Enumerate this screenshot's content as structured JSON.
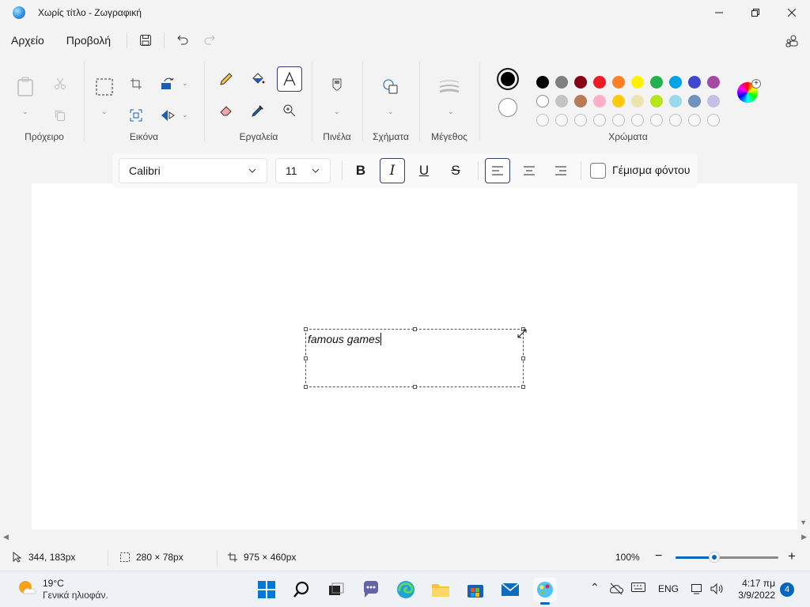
{
  "window": {
    "title": "Χωρίς τίτλο - Ζωγραφική",
    "minimize_icon": "minimize-icon",
    "maximize_icon": "maximize-icon",
    "close_icon": "close-icon"
  },
  "menu": {
    "file": "Αρχείο",
    "view": "Προβολή"
  },
  "ribbon": {
    "groups": {
      "clipboard": "Πρόχειρο",
      "image": "Εικόνα",
      "tools": "Εργαλεία",
      "brushes": "Πινέλα",
      "shapes": "Σχήματα",
      "size": "Μέγεθος",
      "colors": "Χρώματα"
    },
    "primary_color": "#000000",
    "secondary_color": "#ffffff",
    "palette": [
      "#000000",
      "#7f7f7f",
      "#880015",
      "#ed1c24",
      "#ff7f27",
      "#fff200",
      "#22b14c",
      "#00a2e8",
      "#3f48cc",
      "#a349a4",
      "#ffffff",
      "#c3c3c3",
      "#b97a57",
      "#ffaec9",
      "#ffc90e",
      "#efe4b0",
      "#b5e61d",
      "#99d9ea",
      "#7092be",
      "#c8bfe7"
    ],
    "empty_swatches": 10
  },
  "text_toolbar": {
    "font": "Calibri",
    "size": "11",
    "bold": "B",
    "italic": "I",
    "underline": "U",
    "strike": "S",
    "fill_background": "Γέμισμα φόντου"
  },
  "canvas": {
    "text": "famous games"
  },
  "status": {
    "cursor": "344, 183px",
    "selection": "280 × 78px",
    "canvas_size": "975 × 460px",
    "zoom": "100%",
    "zoom_fraction": 0.38
  },
  "taskbar": {
    "temp": "19°C",
    "weather": "Γενικά ηλιοφάν.",
    "lang": "ENG",
    "time": "4:17 πμ",
    "date": "3/9/2022",
    "notifications": "4"
  },
  "colors": {
    "accent": "#0067c0",
    "canvas": "#ffffff",
    "chrome": "#f3f3f3"
  }
}
